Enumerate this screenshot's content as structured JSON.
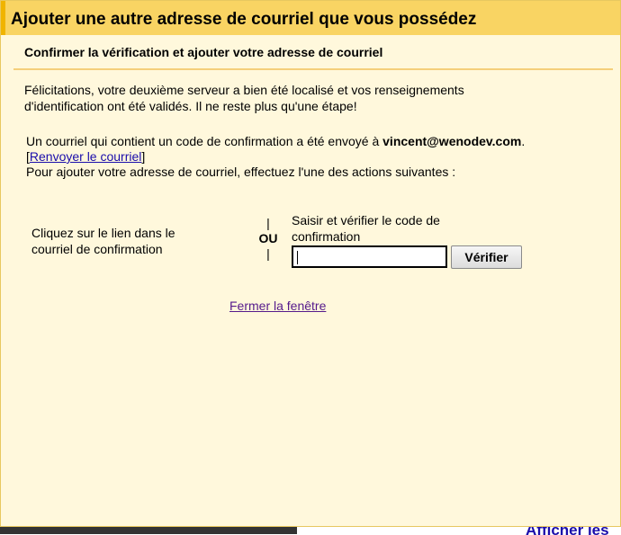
{
  "dialog": {
    "title": "Ajouter une autre adresse de courriel que vous possédez",
    "subtitle": "Confirmer la vérification et ajouter votre adresse de courriel",
    "congrats_line1": "Félicitations, votre deuxième serveur a bien été localisé et vos renseignements",
    "congrats_line2": "d'identification ont été validés. Il ne reste plus qu'une étape!",
    "sent_prefix": "Un courriel qui contient un code de confirmation a été envoyé à ",
    "sent_email": "vincent@wenodev.com",
    "sent_suffix": ".",
    "resend_open": "[",
    "resend_link": "Renvoyer le courriel",
    "resend_close": "]",
    "actions_intro": "Pour ajouter votre adresse de courriel, effectuez l'une des actions suivantes :",
    "option_left_line1": "Cliquez sur le lien dans le",
    "option_left_line2": "courriel de confirmation",
    "separator_bar": "|",
    "separator_text": "OU",
    "option_right_line1": "Saisir et vérifier le code de",
    "option_right_line2": "confirmation",
    "code_input_value": "",
    "verify_button": "Vérifier",
    "close_link": "Fermer la fenêtre"
  },
  "background": {
    "partial_link": "Afficher les"
  },
  "colors": {
    "title_bar": "#f9d463",
    "dialog_bg": "#fff8dc",
    "link": "#1a0dab",
    "visited_link": "#551a8b"
  }
}
